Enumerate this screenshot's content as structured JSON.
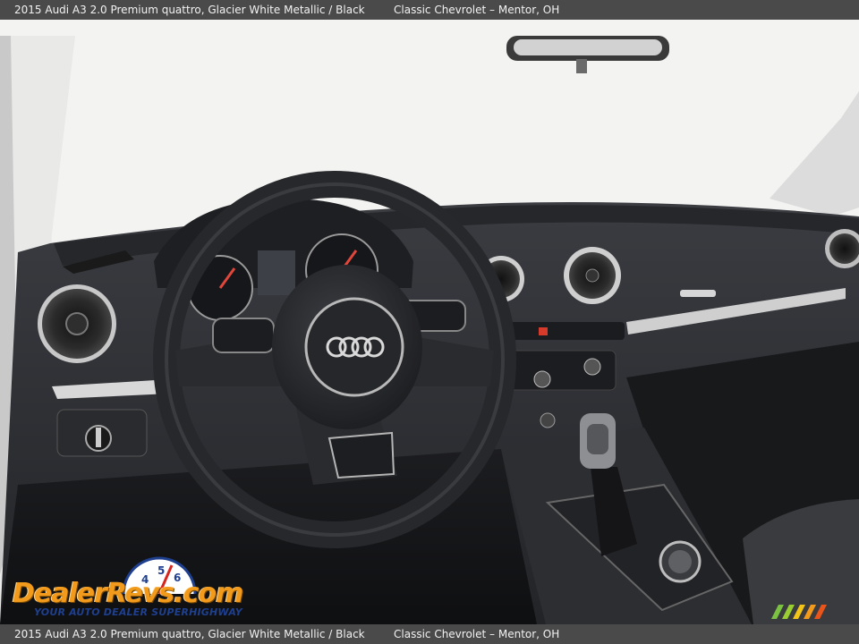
{
  "caption": {
    "vehicle": "2015 Audi A3 2.0 Premium quattro,  Glacier White Metallic / Black",
    "dealer": "Classic Chevrolet – Mentor, OH"
  },
  "watermark": {
    "brand": "DealerRevs.com",
    "tagline": "YOUR AUTO DEALER SUPERHIGHWAY",
    "speedo_digits": "456"
  },
  "steering_wheel": {
    "brand_emblem": "four-rings-icon"
  },
  "colors": {
    "caption_bar": "#4a4a4a",
    "dashboard": "#2a2c30",
    "windshield": "#f4f4f2",
    "logo_orange": "#f29a1c",
    "logo_blue": "#1f3f8f"
  }
}
